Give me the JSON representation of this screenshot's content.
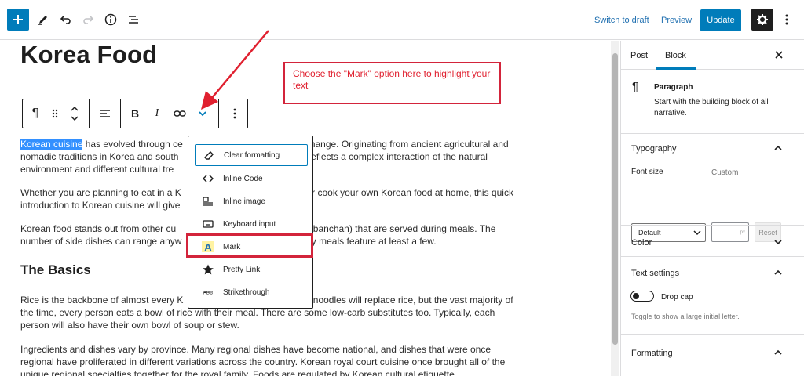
{
  "topbar": {
    "switch_to_draft": "Switch to draft",
    "preview": "Preview",
    "update": "Update"
  },
  "editor": {
    "title": "Korea Food",
    "paragraphs": {
      "p1_highlight": "Korean cuisine",
      "p1_line1_rest": " has evolved through ce",
      "p1_line1_end": "l change. Originating from ancient agricultural and",
      "p1_line2": "nomadic traditions in Korea and south",
      "p1_line2_end": "ne reflects a complex interaction of the natural",
      "p1_line3": "environment and different cultural tre",
      "p2_line1": "Whether you are planning to eat in a K",
      "p2_line1_end": ", or cook your own Korean food at home, this quick",
      "p2_line2": "introduction to Korean cuisine will give",
      "p3_line1": "Korean food stands out from other cu",
      "p3_line1_end": "hes (banchan) that are served during meals. The",
      "p3_line2": "number of side dishes can range anyw",
      "p3_line2_end": "day meals feature at least a few.",
      "h2": "The Basics",
      "p4_line1": "Rice is the backbone of almost every K",
      "p4_line1_end": "ns, noodles will replace rice, but the vast majority of",
      "p4_line2": "the time, every person eats a bowl of rice with their meal. There are some low-carb substitutes too. Typically, each",
      "p4_line3": "person will also have their own bowl of soup or stew.",
      "p5_line1": "Ingredients and dishes vary by province. Many regional dishes have become national, and dishes that were once",
      "p5_line2": "regional have proliferated in different variations across the country. Korean royal court cuisine once brought all of the",
      "p5_line3": "unique regional specialties together for the royal family. Foods are regulated by Korean cultural etiquette."
    },
    "block_toolbar": {
      "paragraph_glyph": "¶",
      "bold": "B",
      "italic": "I"
    },
    "dropdown_items": [
      {
        "label": "Clear formatting",
        "icon": "eraser-icon"
      },
      {
        "label": "Inline Code",
        "icon": "code-icon"
      },
      {
        "label": "Inline image",
        "icon": "image-icon"
      },
      {
        "label": "Keyboard input",
        "icon": "keyboard-icon"
      },
      {
        "label": "Mark",
        "icon": "mark-icon"
      },
      {
        "label": "Pretty Link",
        "icon": "star-icon"
      },
      {
        "label": "Strikethrough",
        "icon": "strikethrough-icon"
      }
    ],
    "callout": "Choose the \"Mark\" option here to highlight your text"
  },
  "sidebar": {
    "tabs": {
      "post": "Post",
      "block": "Block"
    },
    "block_card": {
      "name": "Paragraph",
      "description": "Start with the building block of all narrative."
    },
    "typography": {
      "title": "Typography",
      "font_size_label": "Font size",
      "custom_label": "Custom",
      "selected": "Default",
      "unit": "px",
      "reset": "Reset"
    },
    "color": {
      "title": "Color"
    },
    "text_settings": {
      "title": "Text settings",
      "drop_cap": "Drop cap",
      "help": "Toggle to show a large initial letter."
    },
    "formatting": {
      "title": "Formatting"
    }
  },
  "colors": {
    "accent": "#007cba",
    "annotation": "#d3243b",
    "selection": "#3390ff"
  }
}
